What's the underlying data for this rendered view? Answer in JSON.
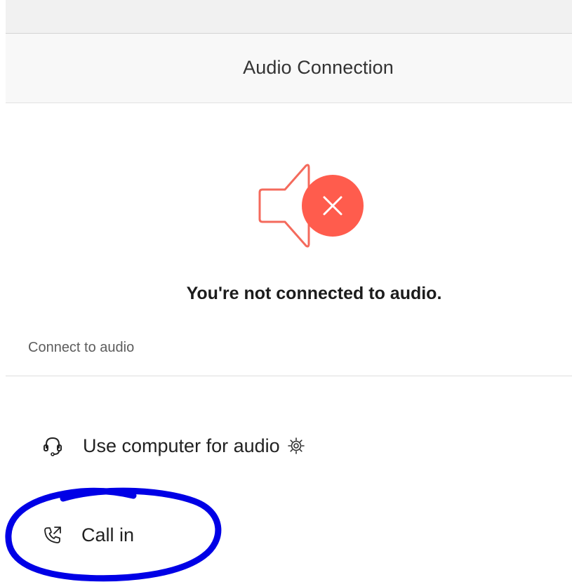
{
  "header": {
    "title": "Audio Connection"
  },
  "status": {
    "message": "You're not connected to audio.",
    "icon": "speaker-muted-icon",
    "icon_color": "#ff5c4d"
  },
  "connect_section": {
    "label": "Connect to audio",
    "options": [
      {
        "label": "Use computer for audio",
        "icon": "headset-icon",
        "has_settings": true
      },
      {
        "label": "Call in",
        "icon": "phone-call-out-icon"
      }
    ]
  },
  "annotation": {
    "shape": "hand-drawn-ellipse",
    "color": "#0000e6"
  }
}
